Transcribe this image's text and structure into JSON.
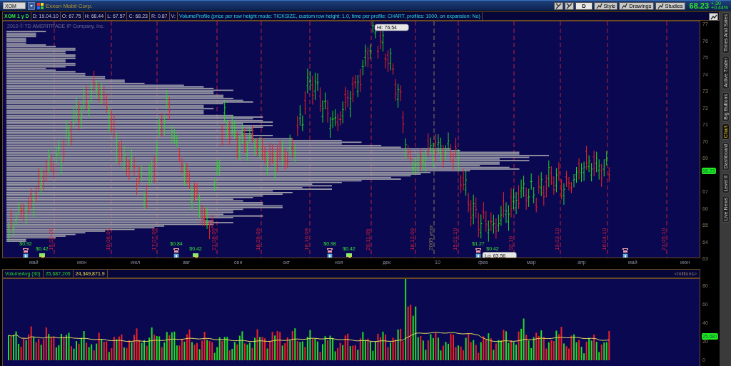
{
  "symbol_bar": {
    "symbol": "XOM",
    "company": "Exxon Mobil Corp."
  },
  "toolbar": {
    "buttons": [
      {
        "label": "D",
        "kind": "text"
      },
      {
        "label": "Style",
        "kind": "icon-text"
      },
      {
        "label": "Drawings",
        "kind": "icon-text"
      },
      {
        "label": "Studies",
        "kind": "icon-text"
      }
    ]
  },
  "quote": {
    "last": "68.23",
    "change": "+.30",
    "change_percent": "+0.44%"
  },
  "header": {
    "title": "XOM 1 y D",
    "fields": [
      "D: 19.04.10",
      "O: 67.75",
      "H: 68.44",
      "L: 67.57",
      "C: 68.23",
      "R: 0.87",
      "V:"
    ],
    "study": "VolumeProfile (price per row height mode: TICKSIZE, custom row height: 1.0, time per profile: CHART, profiles: 1000, on expansion: No)"
  },
  "price_chart": {
    "copyright": "2010 © TD AMERITRADE IP Company, Inc.",
    "high_label": "Hi: 76.54",
    "low_label": "Lo: 63.56",
    "date_markers": [
      {
        "label": "15.05.09",
        "kind": "expiration"
      },
      {
        "label": "19.06.09",
        "kind": "expiration"
      },
      {
        "label": "17.07.09",
        "kind": "expiration"
      },
      {
        "label": "21.08.09",
        "kind": "expiration"
      },
      {
        "label": "18.09.09",
        "kind": "expiration"
      },
      {
        "label": "16.10.09",
        "kind": "expiration"
      },
      {
        "label": "20.11.09",
        "kind": "expiration"
      },
      {
        "label": "18.12.09",
        "kind": "expiration"
      },
      {
        "label": "2009 year",
        "kind": "year"
      },
      {
        "label": "15.01.10",
        "kind": "expiration"
      },
      {
        "label": "02.10",
        "kind": "expiration"
      },
      {
        "label": "19.03.10",
        "kind": "expiration"
      },
      {
        "label": "16.04.10",
        "kind": "expiration"
      },
      {
        "label": "21.05.10",
        "kind": "expiration"
      }
    ],
    "events": [
      {
        "kind": "earnings",
        "value": "$0.92"
      },
      {
        "kind": "dividend",
        "value": "$0.42"
      },
      {
        "kind": "earnings",
        "value": "$0.84"
      },
      {
        "kind": "dividend",
        "value": "$0.42"
      },
      {
        "kind": "earnings",
        "value": "$0.98"
      },
      {
        "kind": "dividend",
        "value": "$0.42"
      },
      {
        "kind": "earnings",
        "value": "$1.27"
      },
      {
        "kind": "dividend",
        "value": "$0.42"
      },
      {
        "kind": "earnings"
      }
    ],
    "y_labels": [
      "77",
      "76",
      "75",
      "74",
      "73",
      "72",
      "71",
      "70",
      "69",
      "67",
      "66",
      "65",
      "64",
      "63"
    ],
    "last_price": "68.23"
  },
  "month_labels": [
    "май",
    "июн",
    "июл",
    "авг",
    "сен",
    "окт",
    "ноя",
    "дек",
    "10",
    "фев",
    "мар",
    "апр",
    "май",
    "июн"
  ],
  "volume": {
    "study": "VolumeAvg (30)",
    "volume": "25,687,205",
    "average": "24,349,871.9",
    "units": "<millions>",
    "y_labels": [
      "80",
      "60",
      "40",
      "20",
      "0"
    ],
    "last_volume": "25.687"
  },
  "side_tabs": [
    {
      "label": "Times And Sales",
      "selected": false
    },
    {
      "label": "Active Trader",
      "selected": false
    },
    {
      "label": "Big Buttons",
      "selected": false
    },
    {
      "label": "Chart",
      "selected": true
    },
    {
      "label": "Dashboard",
      "selected": false
    },
    {
      "label": "Level II",
      "selected": false
    },
    {
      "label": "Live News",
      "selected": false
    }
  ]
}
